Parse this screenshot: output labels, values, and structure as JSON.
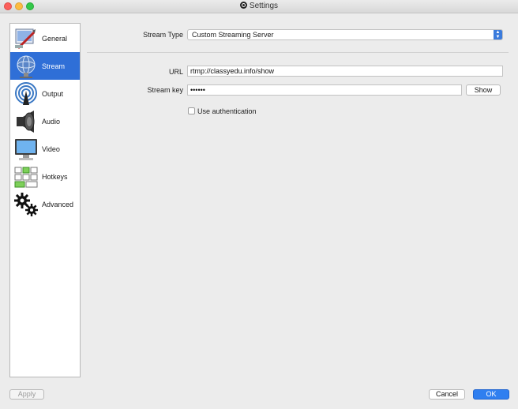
{
  "window": {
    "title": "Settings"
  },
  "sidebar": {
    "items": [
      {
        "label": "General",
        "icon": "general-icon"
      },
      {
        "label": "Stream",
        "icon": "stream-icon",
        "selected": true
      },
      {
        "label": "Output",
        "icon": "output-icon"
      },
      {
        "label": "Audio",
        "icon": "audio-icon"
      },
      {
        "label": "Video",
        "icon": "video-icon"
      },
      {
        "label": "Hotkeys",
        "icon": "hotkeys-icon"
      },
      {
        "label": "Advanced",
        "icon": "advanced-icon"
      }
    ]
  },
  "stream": {
    "stream_type_label": "Stream Type",
    "stream_type_value": "Custom Streaming Server",
    "url_label": "URL",
    "url_value": "rtmp://classyedu.info/show",
    "key_label": "Stream key",
    "key_value": "••••••",
    "show_button": "Show",
    "auth_label": "Use authentication",
    "auth_checked": false
  },
  "footer": {
    "apply_button": "Apply",
    "cancel_button": "Cancel",
    "ok_button": "OK"
  },
  "colors": {
    "accent": "#2f6fd7",
    "ok_button": "#2f7ff0"
  }
}
